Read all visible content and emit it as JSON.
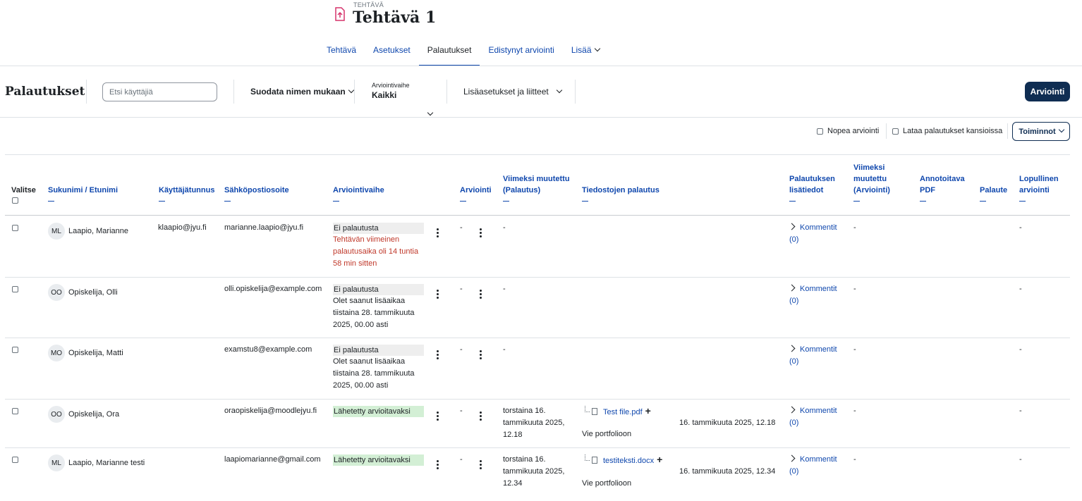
{
  "header": {
    "activity_type": "TEHTÄVÄ",
    "title": "Tehtävä 1"
  },
  "tabs": [
    {
      "label": "Tehtävä"
    },
    {
      "label": "Asetukset"
    },
    {
      "label": "Palautukset",
      "active": true
    },
    {
      "label": "Edistynyt arviointi"
    },
    {
      "label": "Lisää"
    }
  ],
  "toolbar": {
    "title": "Palautukset",
    "search_placeholder": "Etsi käyttäjiä",
    "filter_name": "Suodata nimen mukaan",
    "stage_label": "Arviointivaihe",
    "stage_value": "Kaikki",
    "advanced": "Lisäasetukset ja liitteet",
    "grade_button": "Arviointi"
  },
  "options": {
    "quick_grading": "Nopea arviointi",
    "download_folders": "Lataa palautukset kansioissa",
    "actions": "Toiminnot"
  },
  "columns": {
    "select": "Valitse",
    "name": "Sukunimi / Etunimi",
    "username": "Käyttäjätunnus",
    "email": "Sähköpostiosoite",
    "status": "Arviointivaihe",
    "grade": "Arviointi",
    "modified_sub_1": "Viimeksi muutettu",
    "modified_sub_2": "(Palautus)",
    "files": "Tiedostojen palautus",
    "comments_1": "Palautuksen",
    "comments_2": "lisätiedot",
    "modified_grade_1": "Viimeksi",
    "modified_grade_2": "muutettu",
    "modified_grade_3": "(Arviointi)",
    "pdf_1": "Annotoitava",
    "pdf_2": "PDF",
    "feedback": "Palaute",
    "final_1": "Lopullinen",
    "final_2": "arviointi"
  },
  "rows": [
    {
      "initials": "ML",
      "name": "Laapio, Marianne",
      "username": "klaapio@jyu.fi",
      "email": "marianne.laapio@jyu.fi",
      "status": "Ei palautusta",
      "note_1": "Tehtävän viimeinen",
      "note_2": "palautusaika oli 14 tuntia",
      "note_3": "58 min sitten",
      "grade": "-",
      "modified": "-",
      "comments": "Kommentit",
      "comments_count": "(0)",
      "modified_grade": "-",
      "final": "-"
    },
    {
      "initials": "OO",
      "name": "Opiskelija, Olli",
      "username": "",
      "email": "olli.opiskelija@example.com",
      "status": "Ei palautusta",
      "note_1": "Olet saanut lisäaikaa",
      "note_2": "tiistaina 28. tammikuuta",
      "note_3": "2025, 00.00 asti",
      "grade": "-",
      "modified": "-",
      "comments": "Kommentit",
      "comments_count": "(0)",
      "modified_grade": "-",
      "final": "-"
    },
    {
      "initials": "MO",
      "name": "Opiskelija, Matti",
      "username": "",
      "email": "examstu8@example.com",
      "status": "Ei palautusta",
      "note_1": "Olet saanut lisäaikaa",
      "note_2": "tiistaina 28. tammikuuta",
      "note_3": "2025, 00.00 asti",
      "grade": "-",
      "modified": "-",
      "comments": "Kommentit",
      "comments_count": "(0)",
      "modified_grade": "-",
      "final": "-"
    },
    {
      "initials": "OO",
      "name": "Opiskelija, Ora",
      "username": "",
      "email": "oraopiskelija@moodlejyu.fi",
      "status": "Lähetetty arvioitavaksi",
      "grade": "-",
      "modified_1": "torstaina 16.",
      "modified_2": "tammikuuta 2025,",
      "modified_3": "12.18",
      "file": "Test file.pdf",
      "file_date": "16. tammikuuta 2025, 12.18",
      "portfolio": "Vie portfolioon",
      "comments": "Kommentit",
      "comments_count": "(0)",
      "modified_grade": "-",
      "final": "-"
    },
    {
      "initials": "ML",
      "name": "Laapio, Marianne testi",
      "username": "",
      "email": "laapiomarianne@gmail.com",
      "status": "Lähetetty arvioitavaksi",
      "grade": "-",
      "modified_1": "torstaina 16.",
      "modified_2": "tammikuuta 2025,",
      "modified_3": "12.34",
      "file": "testiteksti.docx",
      "file_date": "16. tammikuuta 2025, 12.34",
      "portfolio": "Vie portfolioon",
      "comments": "Kommentit",
      "comments_count": "(0)",
      "modified_grade": "-",
      "final": "-"
    }
  ]
}
